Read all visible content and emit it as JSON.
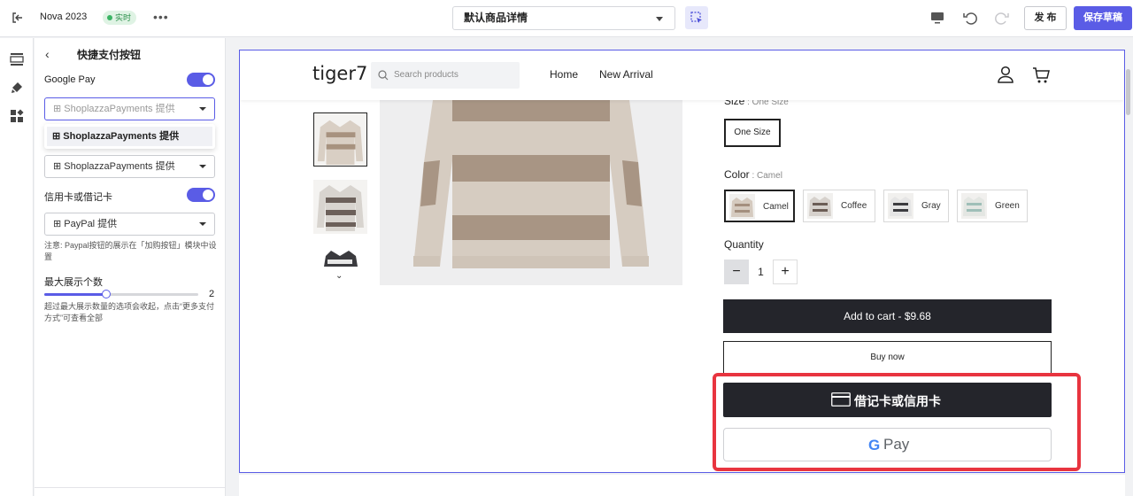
{
  "topbar": {
    "theme_name": "Nova 2023",
    "live_badge": "实时",
    "more": "•••",
    "page_select": "默认商品详情",
    "publish": "发 布",
    "save": "保存草稿"
  },
  "panel": {
    "back": "‹",
    "title": "快捷支付按钮",
    "google_pay_label": "Google Pay",
    "google_pay_enabled": true,
    "provider_select_value": "⊞ ShoplazzaPayments 提供",
    "provider_menu_option": "⊞ ShoplazzaPayments 提供",
    "provider_select2_value": "⊞ ShoplazzaPayments 提供",
    "card_label": "信用卡或借记卡",
    "card_enabled": true,
    "paypal_select_value": "⊞ PayPal 提供",
    "paypal_note": "注意: Paypal按钮的展示在「加购按钮」模块中设置",
    "max_label": "最大展示个数",
    "max_value": "2",
    "max_fraction": 0.4,
    "max_note": "超过最大展示数量的选项会收起，点击“更多支付方式”可查看全部"
  },
  "store": {
    "logo": "tiger7",
    "search_placeholder": "Search products",
    "nav": [
      "Home",
      "New Arrival"
    ],
    "size_label": "Size",
    "size_value": " : One Size",
    "size_option": "One Size",
    "color_label": "Color",
    "color_value": " : Camel",
    "colors": [
      "Camel",
      "Coffee",
      "Gray",
      "Green"
    ],
    "quantity_label": "Quantity",
    "qty_minus": "−",
    "qty_value": "1",
    "qty_plus": "+",
    "add_to_cart": "Add to cart  -  $9.68",
    "buy_now": "Buy now",
    "card_button": "借记卡或信用卡",
    "gpay_g": "G",
    "gpay_text": "Pay",
    "thumb_arrow": "⌄"
  },
  "colors": {
    "accent": "#5a5ce6",
    "highlight": "#e8343f",
    "button_dark": "#24252b"
  }
}
